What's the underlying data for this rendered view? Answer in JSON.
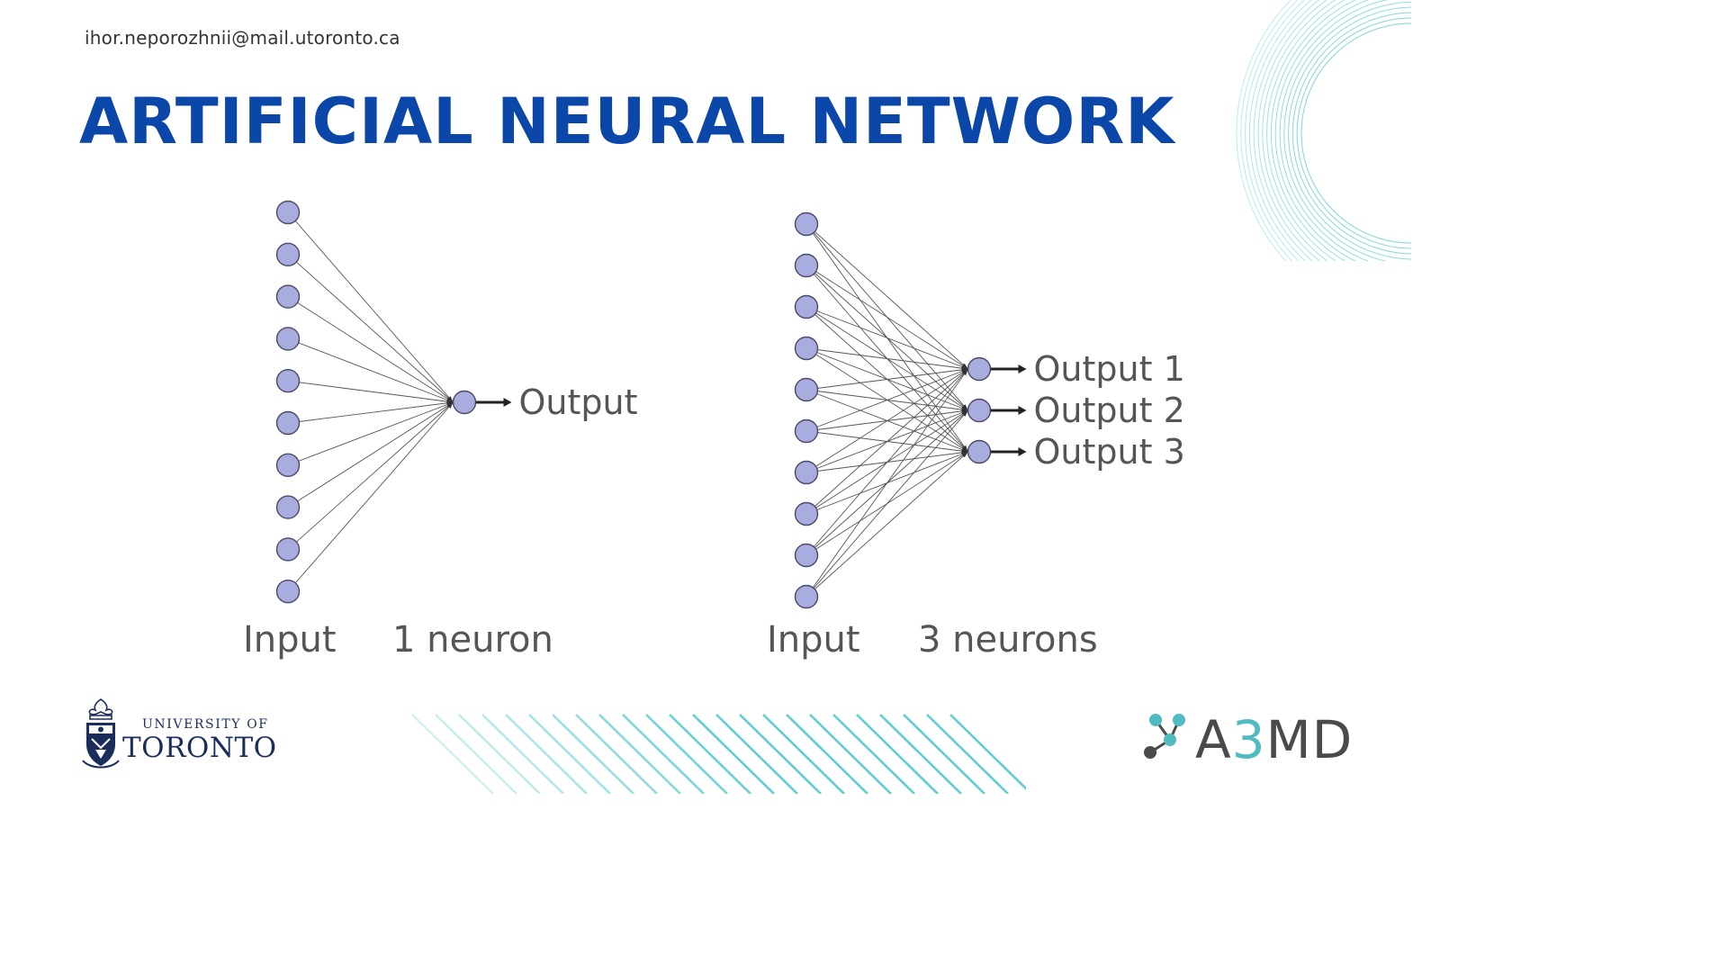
{
  "header": {
    "email": "ihor.neporozhnii@mail.utoronto.ca",
    "title": "ARTIFICIAL NEURAL NETWORK"
  },
  "left_network": {
    "input_count": 10,
    "output_count": 1,
    "outputs": [
      "Output"
    ],
    "input_label": "Input",
    "layer_label": "1 neuron"
  },
  "right_network": {
    "input_count": 10,
    "output_count": 3,
    "outputs": [
      "Output 1",
      "Output 2",
      "Output 3"
    ],
    "input_label": "Input",
    "layer_label": "3 neurons"
  },
  "logos": {
    "uoft_line1": "UNIVERSITY OF",
    "uoft_line2": "TORONTO",
    "a3md_prefix": "A",
    "a3md_accent": "3",
    "a3md_suffix": "MD"
  },
  "colors": {
    "title": "#0a47a8",
    "node_fill": "#a9acdf",
    "node_stroke": "#4a4a66",
    "edge": "#555555",
    "label_text": "#555555",
    "decor_teal": "#4fc9cf",
    "uoft_navy": "#1b2d5c",
    "a3md_teal": "#4fbcc2",
    "a3md_gray": "#4a4a4a"
  }
}
